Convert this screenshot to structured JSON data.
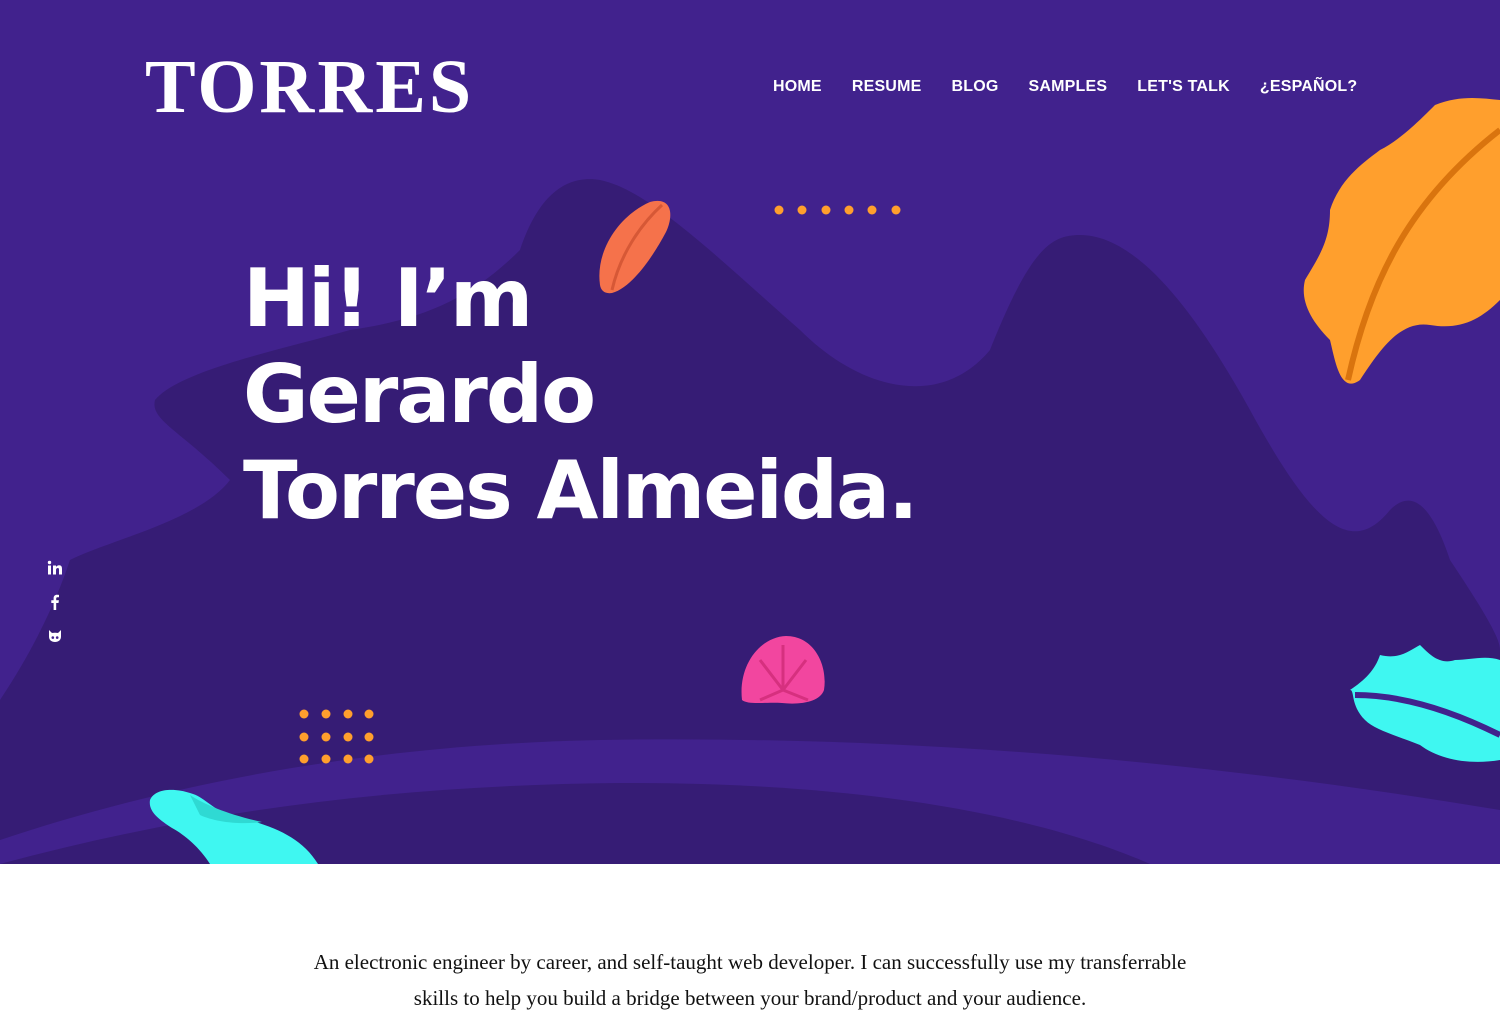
{
  "brand": {
    "logo_text": "TORRES"
  },
  "nav": {
    "items": [
      {
        "label": "HOME"
      },
      {
        "label": "RESUME"
      },
      {
        "label": "BLOG"
      },
      {
        "label": "SAMPLES"
      },
      {
        "label": "LET'S TALK"
      },
      {
        "label": "¿ESPAÑOL?"
      }
    ]
  },
  "hero": {
    "lines": [
      "Hi! I’m",
      "Gerardo",
      "Torres Almeida."
    ]
  },
  "social": [
    {
      "icon": "linkedin-icon",
      "glyph": "in"
    },
    {
      "icon": "facebook-icon",
      "glyph": "f"
    },
    {
      "icon": "github-icon",
      "glyph": ""
    }
  ],
  "intro": {
    "text": "An electronic engineer by career, and self-taught web developer. I can successfully use my transferrable skills to help you build a bridge between your brand/product and your audience."
  },
  "colors": {
    "hero_bg": "#41228d",
    "hero_shape": "#361c75",
    "accent_orange": "#ff9f2d",
    "accent_coral": "#f5724b",
    "accent_pink": "#f2469f",
    "accent_cyan": "#3ff7f1"
  }
}
